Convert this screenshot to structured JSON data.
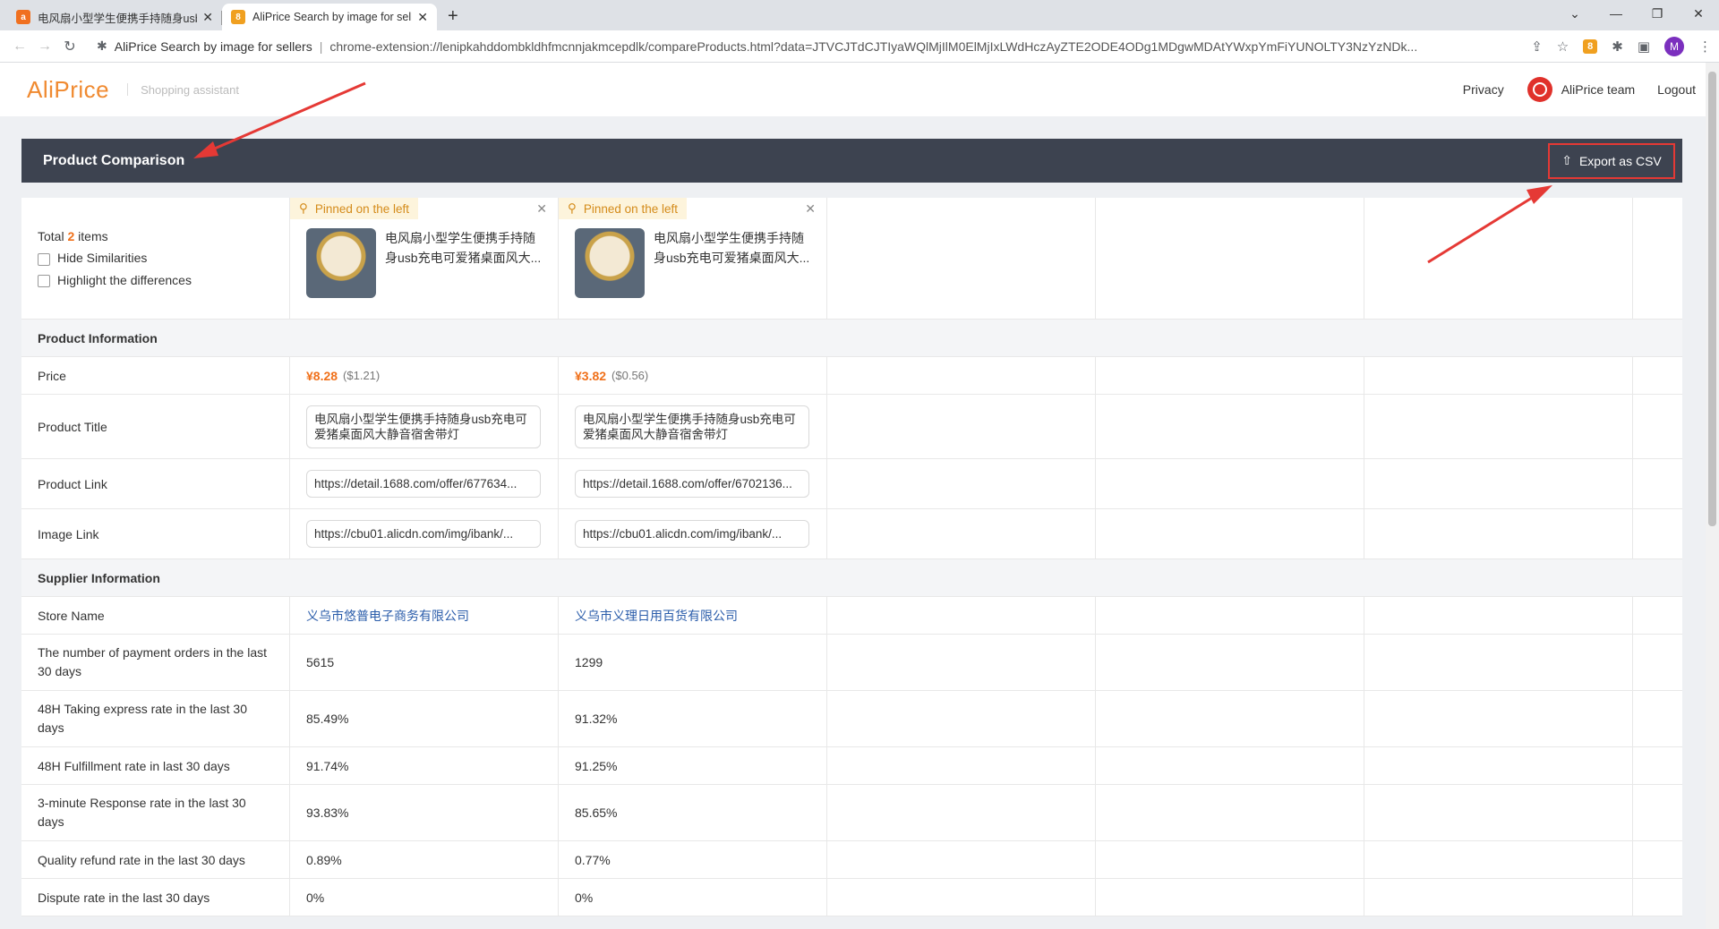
{
  "browser": {
    "tabs": [
      {
        "title": "电风扇小型学生便携手持随身usb充电可爱猪桌面风大静音宿舍带灯",
        "favicon_color": "#f07020",
        "favicon": "alibaba-icon"
      },
      {
        "title": "AliPrice Search by image for sellers",
        "favicon_color": "#f0a020",
        "favicon": "aliprice-icon"
      }
    ],
    "omnibox": {
      "site_name": "AliPrice Search by image for sellers",
      "url": "chrome-extension://lenipkahddombkldhfmcnnjakmcepdlk/compareProducts.html?data=JTVCJTdCJTIyaWQlMjIlM0ElMjIxLWdHczAyZTE2ODE4ODg1MDgwMDAtYWxpYmFiYUNOLTY3NzYzNDk..."
    },
    "ext_badge": "8",
    "profile_initial": "M"
  },
  "header": {
    "logo": "AliPrice",
    "tagline": "Shopping assistant",
    "privacy": "Privacy",
    "team": "AliPrice team",
    "logout": "Logout"
  },
  "compare": {
    "title": "Product Comparison",
    "export": "Export as CSV",
    "total_prefix": "Total",
    "total_count": "2",
    "total_suffix": "items",
    "hide_similarities": "Hide Similarities",
    "highlight_diff": "Highlight the differences",
    "pinned_label": "Pinned on the left",
    "products": [
      {
        "title_short": "电风扇小型学生便携手持随身usb充电可爱猪桌面风大...",
        "price": "¥8.28",
        "usd": "($1.21)",
        "title_full": "电风扇小型学生便携手持随身usb充电可爱猪桌面风大静音宿舍带灯",
        "link": "https://detail.1688.com/offer/677634...",
        "image_link": "https://cbu01.alicdn.com/img/ibank/...",
        "store": "义乌市悠普电子商务有限公司",
        "orders": "5615",
        "express_rate": "85.49%",
        "fulfillment_rate": "91.74%",
        "response_rate": "93.83%",
        "refund_rate": "0.89%",
        "dispute_rate": "0%"
      },
      {
        "title_short": "电风扇小型学生便携手持随身usb充电可爱猪桌面风大...",
        "price": "¥3.82",
        "usd": "($0.56)",
        "title_full": "电风扇小型学生便携手持随身usb充电可爱猪桌面风大静音宿舍带灯",
        "link": "https://detail.1688.com/offer/6702136...",
        "image_link": "https://cbu01.alicdn.com/img/ibank/...",
        "store": "义乌市义理日用百货有限公司",
        "orders": "1299",
        "express_rate": "91.32%",
        "fulfillment_rate": "91.25%",
        "response_rate": "85.65%",
        "refund_rate": "0.77%",
        "dispute_rate": "0%"
      }
    ],
    "sections": {
      "product_info": "Product Information",
      "supplier_info": "Supplier Information"
    },
    "labels": {
      "price": "Price",
      "product_title": "Product Title",
      "product_link": "Product Link",
      "image_link": "Image Link",
      "store_name": "Store Name",
      "orders": "The number of payment orders in the last 30 days",
      "express": "48H Taking express rate in the last 30 days",
      "fulfillment": "48H Fulfillment rate in last 30 days",
      "response": "3-minute Response rate in the last 30 days",
      "refund": "Quality refund rate in the last 30 days",
      "dispute": "Dispute rate in the last 30 days"
    }
  },
  "colors": {
    "accent": "#f08a30",
    "header_bar": "#3d4350",
    "highlight_box": "#e53935",
    "price": "#f0701a"
  }
}
